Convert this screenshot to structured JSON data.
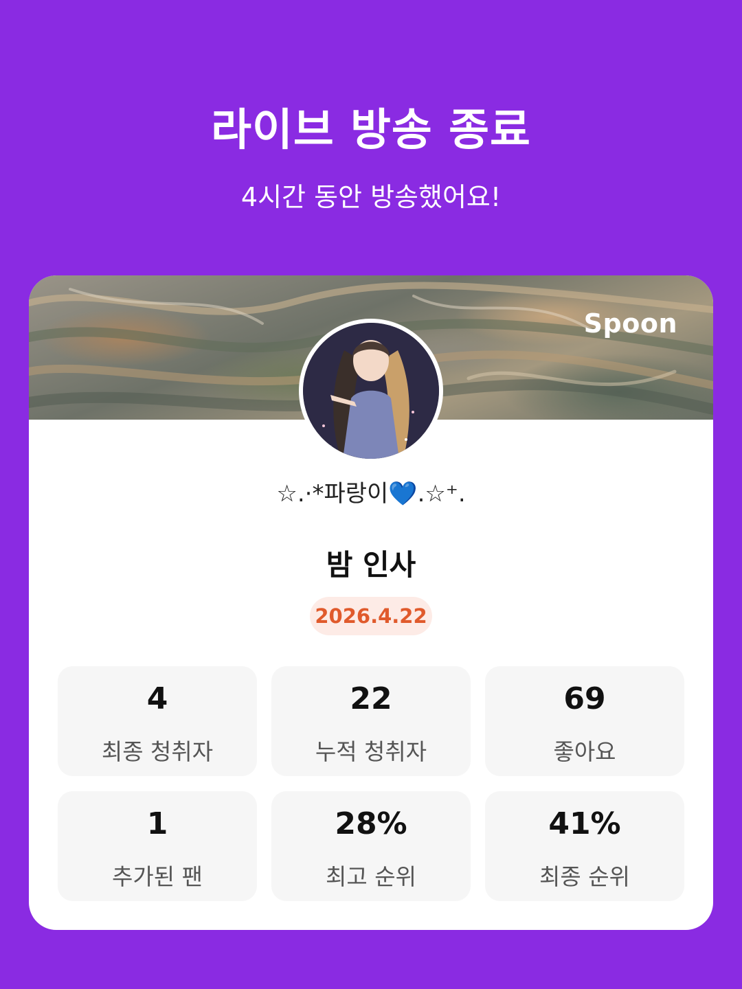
{
  "header": {
    "title": "라이브 방송 종료",
    "subtitle": "4시간 동안 방송했어요!"
  },
  "card": {
    "brand": "Spoon",
    "nickname": "☆.·*파랑이💙.☆⁺.",
    "broadcast_title": "밤 인사",
    "date": "2026.4.22",
    "stats": [
      {
        "value": "4",
        "label": "최종 청취자"
      },
      {
        "value": "22",
        "label": "누적 청취자"
      },
      {
        "value": "69",
        "label": "좋아요"
      },
      {
        "value": "1",
        "label": "추가된 팬"
      },
      {
        "value": "28%",
        "label": "최고 순위"
      },
      {
        "value": "41%",
        "label": "최종 순위"
      }
    ]
  },
  "colors": {
    "background": "#8a2be2",
    "card": "#ffffff",
    "stat_tile": "#f6f6f6",
    "date_badge_bg": "#fdebe6",
    "date_badge_text": "#e05a2c"
  }
}
